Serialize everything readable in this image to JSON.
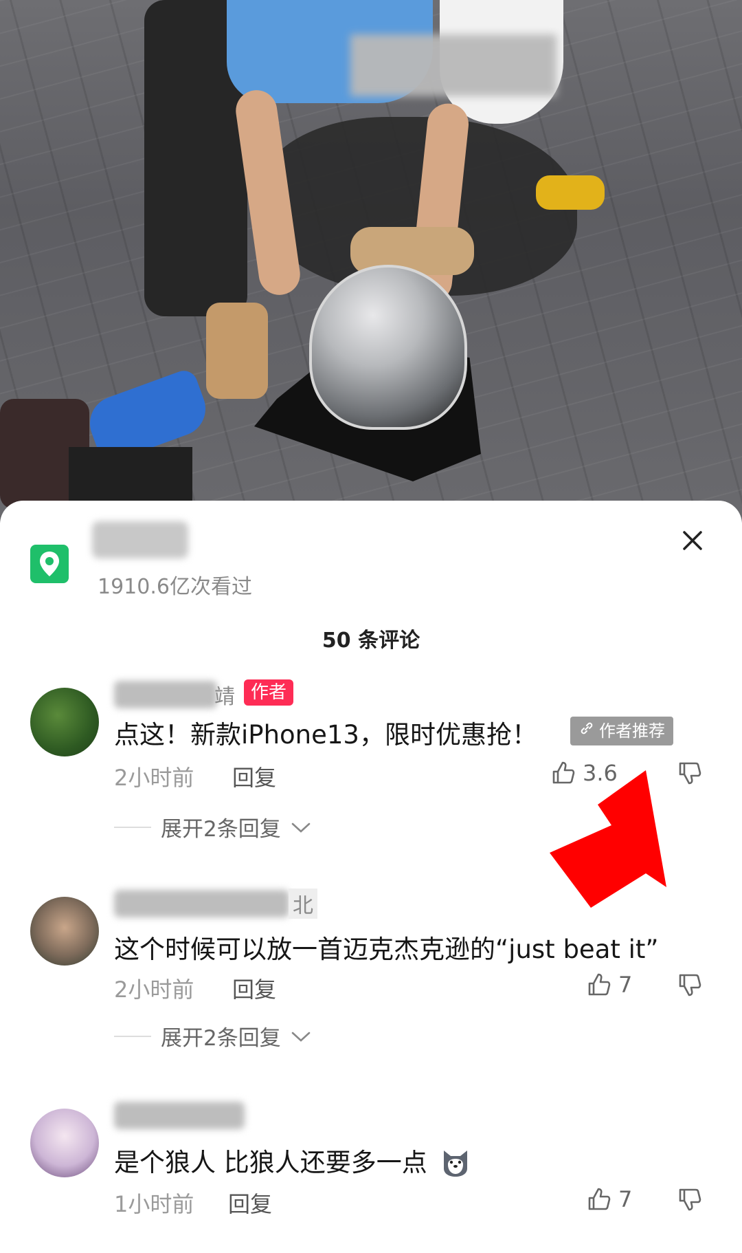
{
  "sheet": {
    "location_views": "1910.6亿次看过",
    "comment_count": "50 条评论"
  },
  "comments": [
    {
      "name_tail": "靖",
      "badge": "作者",
      "text": "点这！新款iPhone13，限时优惠抢！",
      "tag": "作者推荐",
      "time": "2小时前",
      "reply": "回复",
      "likes": "3.6",
      "expand": "展开2条回复"
    },
    {
      "name_tail": "北",
      "text": "这个时候可以放一首迈克杰克逊的“just beat it”",
      "time": "2小时前",
      "reply": "回复",
      "likes": "7",
      "expand": "展开2条回复"
    },
    {
      "text": "是个狼人  比狼人还要多一点",
      "time": "1小时前",
      "reply": "回复",
      "likes": "7"
    }
  ],
  "colors": {
    "accent_red": "#fe2c55",
    "location_green": "#1fbf6a",
    "annotation_arrow": "#ff0000"
  }
}
